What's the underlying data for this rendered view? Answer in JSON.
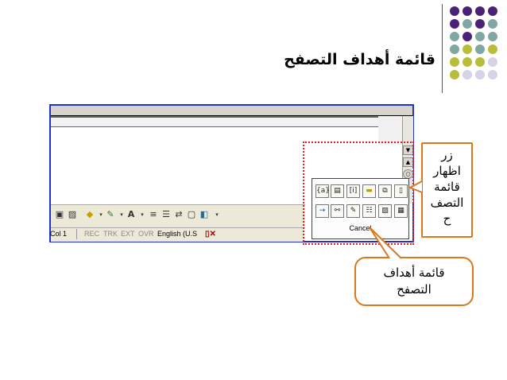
{
  "slide": {
    "title": "قائمة أهداف التصفح",
    "accent_colors": {
      "purple": "#4b2275",
      "teal": "#7fa8a2",
      "olive": "#b8bd3a",
      "lavender": "#d6d3e8",
      "callout_border": "#d87a1c",
      "highlight": "#e02020",
      "frame": "#2233cc"
    }
  },
  "callouts": {
    "right": {
      "lines": [
        "زر",
        "اظهار",
        "قائمة",
        "التصف",
        "ح"
      ]
    },
    "bottom": {
      "lines": [
        "قائمة أهداف",
        "التصفح"
      ]
    }
  },
  "status_bar": {
    "col": "Col 1",
    "rec": "REC",
    "trk": "TRK",
    "ext": "EXT",
    "ovr": "OVR",
    "language": "English (U.S"
  },
  "browse_popup": {
    "cancel_label": "Cancel",
    "row1_icons": [
      "field-icon",
      "endnote-icon",
      "footnote-icon",
      "comment-icon",
      "section-icon",
      "page-icon"
    ],
    "row2_icons": [
      "goto-icon",
      "find-icon",
      "edits-icon",
      "heading-icon",
      "graphic-icon",
      "table-icon"
    ]
  },
  "draw_toolbar": {
    "icons": [
      "clipart-icon",
      "picture-icon",
      "fill-color-icon",
      "line-color-icon",
      "font-color-icon",
      "line-style-icon",
      "dash-style-icon",
      "arrow-style-icon",
      "shadow-icon",
      "3d-icon"
    ]
  }
}
